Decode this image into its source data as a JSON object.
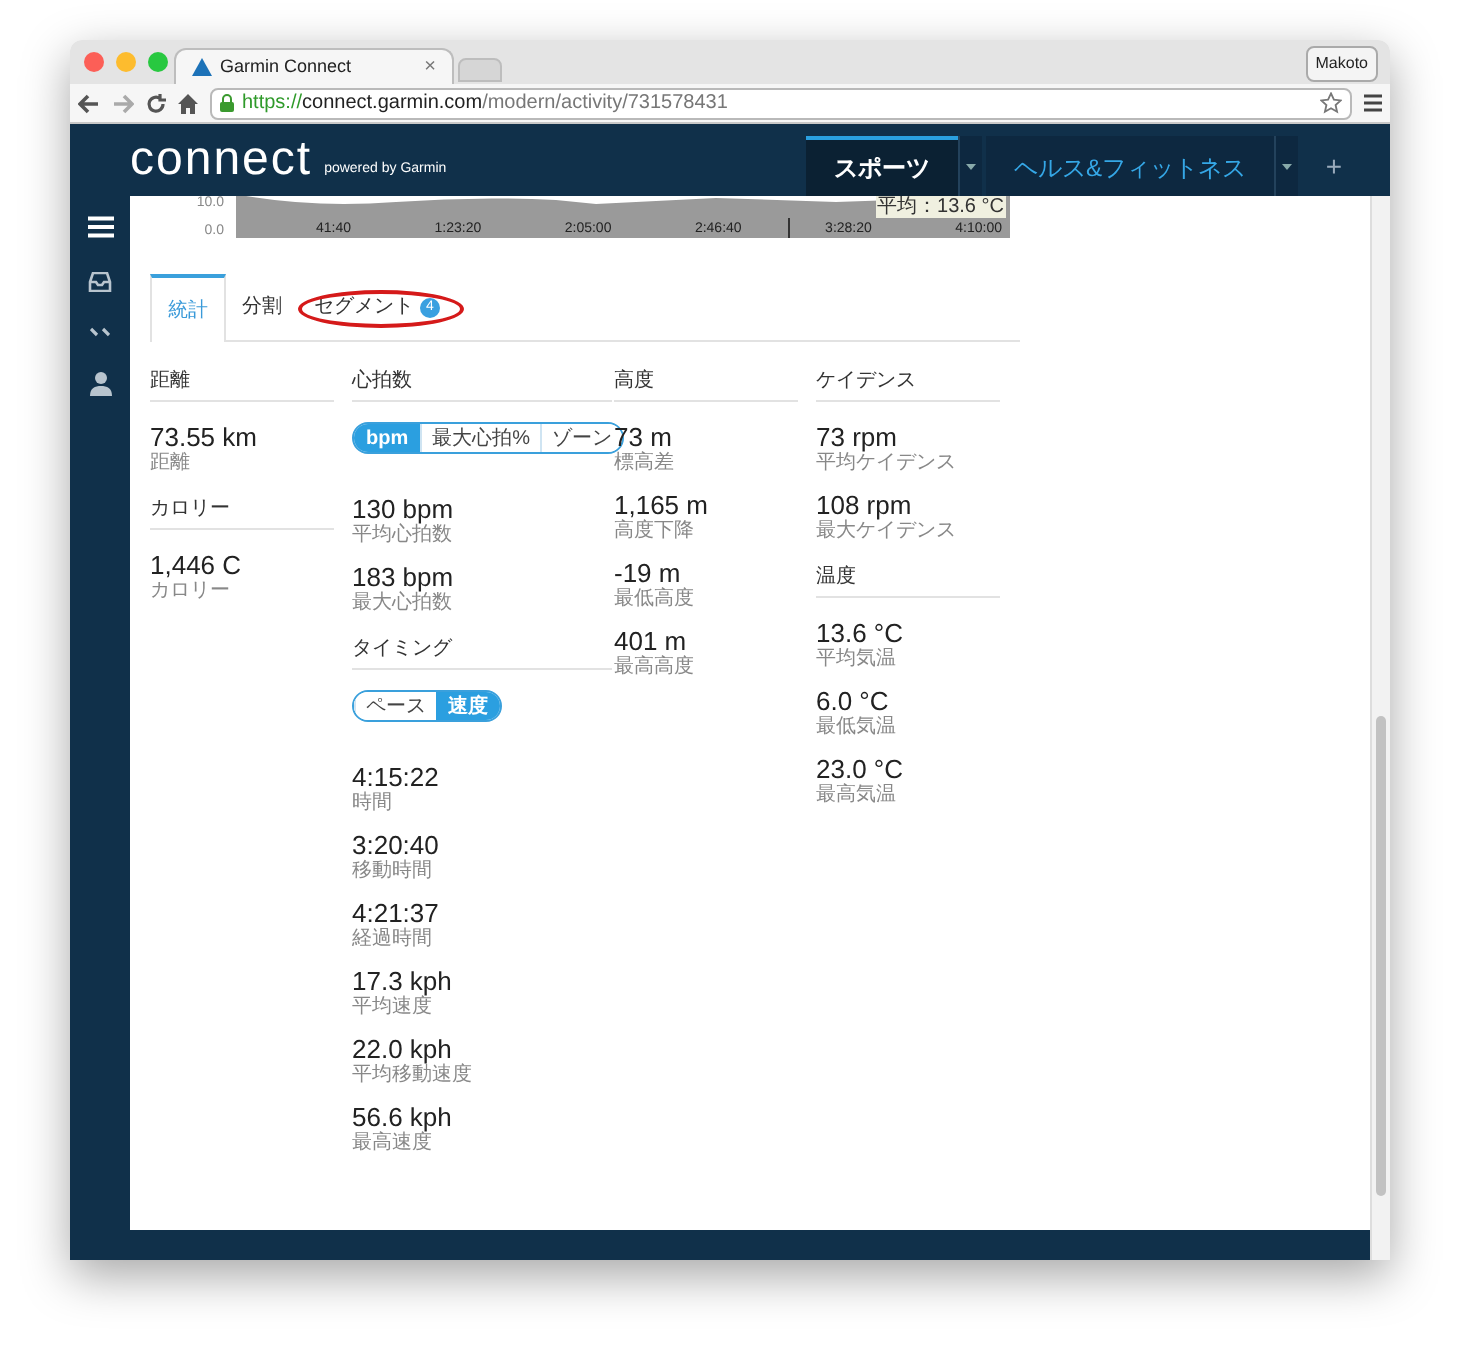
{
  "browser": {
    "tab_title": "Garmin Connect",
    "tab_close": "×",
    "profile": "Makoto",
    "url": {
      "scheme": "https://",
      "host": "connect.garmin.com",
      "path": "/modern/activity/731578431"
    }
  },
  "header": {
    "logo": "connect",
    "powered_by": "powered by Garmin",
    "nav_tabs": [
      {
        "label": "スポーツ",
        "selected": true
      },
      {
        "label": "ヘルス&フィットネス",
        "selected": false
      }
    ],
    "add": "+"
  },
  "chart": {
    "y_labels": [
      "10.0",
      "0.0"
    ],
    "x_labels": [
      "41:40",
      "1:23:20",
      "2:05:00",
      "2:46:40",
      "3:28:20",
      "4:10:00"
    ],
    "tooltip": "平均：13.6 °C"
  },
  "tabs": [
    {
      "label": "統計",
      "selected": true,
      "circled": false
    },
    {
      "label": "分割",
      "selected": false,
      "circled": false
    },
    {
      "label": "セグメント",
      "selected": false,
      "badge": "4",
      "circled": true
    }
  ],
  "columns": [
    [
      {
        "title": "距離",
        "stats": [
          {
            "value": "73.55 km",
            "label": "距離"
          }
        ]
      },
      {
        "title": "カロリー",
        "stats": [
          {
            "value": "1,446 C",
            "label": "カロリー"
          }
        ]
      }
    ],
    [
      {
        "title": "心拍数",
        "toggle": [
          {
            "label": "bpm",
            "selected": true
          },
          {
            "label": "最大心拍%",
            "selected": false
          },
          {
            "label": "ゾーン",
            "selected": false
          }
        ],
        "stats": [
          {
            "value": "130 bpm",
            "label": "平均心拍数"
          },
          {
            "value": "183 bpm",
            "label": "最大心拍数"
          }
        ]
      },
      {
        "title": "タイミング",
        "toggle": [
          {
            "label": "ペース",
            "selected": false
          },
          {
            "label": "速度",
            "selected": true
          }
        ],
        "stats": [
          {
            "value": "4:15:22",
            "label": "時間"
          },
          {
            "value": "3:20:40",
            "label": "移動時間"
          },
          {
            "value": "4:21:37",
            "label": "経過時間"
          },
          {
            "value": "17.3 kph",
            "label": "平均速度"
          },
          {
            "value": "22.0 kph",
            "label": "平均移動速度"
          },
          {
            "value": "56.6 kph",
            "label": "最高速度"
          }
        ]
      }
    ],
    [
      {
        "title": "高度",
        "stats": [
          {
            "value": "73 m",
            "label": "標高差"
          },
          {
            "value": "1,165 m",
            "label": "高度下降"
          },
          {
            "value": "-19 m",
            "label": "最低高度"
          },
          {
            "value": "401 m",
            "label": "最高高度"
          }
        ]
      }
    ],
    [
      {
        "title": "ケイデンス",
        "stats": [
          {
            "value": "73 rpm",
            "label": "平均ケイデンス"
          },
          {
            "value": "108 rpm",
            "label": "最大ケイデンス"
          }
        ]
      },
      {
        "title": "温度",
        "stats": [
          {
            "value": "13.6 °C",
            "label": "平均気温"
          },
          {
            "value": "6.0 °C",
            "label": "最低気温"
          },
          {
            "value": "23.0 °C",
            "label": "最高気温"
          }
        ]
      }
    ]
  ]
}
